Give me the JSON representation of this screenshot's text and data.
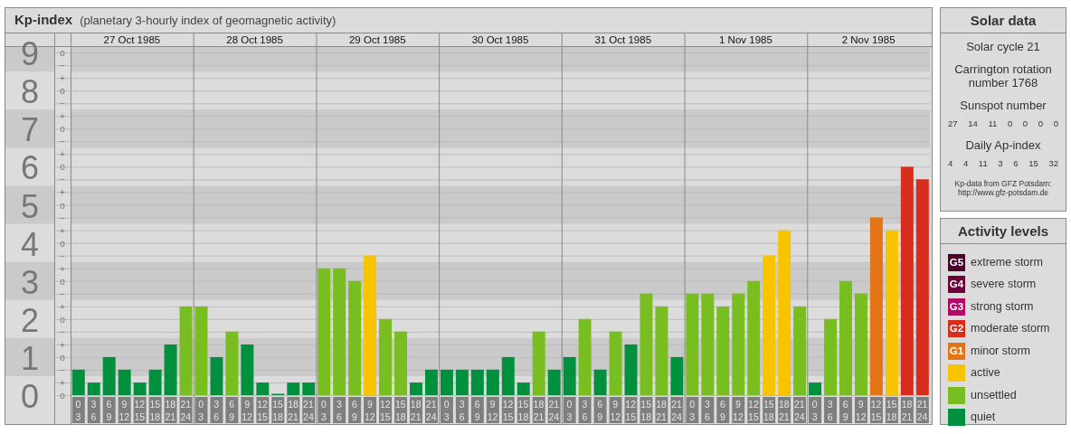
{
  "header": {
    "title": "Kp-index",
    "subtitle": "(planetary 3-hourly index of geomagnetic activity)"
  },
  "days": [
    "27 Oct 1985",
    "28 Oct 1985",
    "29 Oct 1985",
    "30 Oct 1985",
    "31 Oct 1985",
    "1 Nov 1985",
    "2 Nov 1985"
  ],
  "minor_tick_labels": [
    "o",
    "−",
    "+",
    "o",
    "−",
    "+",
    "o",
    "−",
    "+",
    "o",
    "−",
    "+",
    "o",
    "−",
    "+",
    "o",
    "−",
    "+",
    "o",
    "−",
    "+",
    "o",
    "−",
    "+",
    "o",
    "−",
    "+",
    "o"
  ],
  "chart": {
    "chart_data": {
      "type": "bar",
      "grid": true,
      "ylim": [
        0,
        9.17
      ],
      "bands": [
        {
          "axis": "y",
          "from": 0.5,
          "to": 1.5
        },
        {
          "axis": "y",
          "from": 2.5,
          "to": 3.5
        },
        {
          "axis": "y",
          "from": 4.5,
          "to": 5.5
        },
        {
          "axis": "y",
          "from": 6.5,
          "to": 7.5
        },
        {
          "axis": "y",
          "from": 8.5,
          "to": 9.17
        }
      ],
      "yticks": [
        0,
        1,
        2,
        3,
        4,
        5,
        6,
        7,
        8,
        9
      ],
      "categories": [
        "0 3",
        "3 6",
        "6 9",
        "9 12",
        "12 15",
        "15 18",
        "18 21",
        "21 24",
        "0 3",
        "3 6",
        "6 9",
        "9 12",
        "12 15",
        "15 18",
        "18 21",
        "21 24",
        "0 3",
        "3 6",
        "6 9",
        "9 12",
        "12 15",
        "15 18",
        "18 21",
        "21 24",
        "0 3",
        "3 6",
        "6 9",
        "9 12",
        "12 15",
        "15 18",
        "18 21",
        "21 24",
        "0 3",
        "3 6",
        "6 9",
        "9 12",
        "12 15",
        "15 18",
        "18 21",
        "21 24",
        "0 3",
        "3 6",
        "6 9",
        "9 12",
        "12 15",
        "15 18",
        "18 21",
        "21 24",
        "0 3",
        "3 6",
        "6 9",
        "9 12",
        "12 15",
        "15 18",
        "18 21",
        "21 24"
      ],
      "series": [
        {
          "color": "#00903e",
          "values": [
            0.67,
            0.33,
            1,
            0.67,
            0.33,
            0.67,
            1.33,
            null,
            null,
            1,
            null,
            1.33,
            0.33,
            0,
            0.33,
            0.33,
            null,
            null,
            null,
            null,
            null,
            null,
            0.33,
            0.67,
            0.67,
            0.67,
            0.67,
            0.67,
            1,
            0.33,
            null,
            0.67,
            1,
            null,
            0.67,
            null,
            1.33,
            null,
            null,
            1,
            null,
            null,
            null,
            null,
            null,
            null,
            null,
            null,
            0.33,
            null,
            null,
            null,
            null,
            null,
            null,
            null
          ]
        },
        {
          "color": "#78be20",
          "values": [
            null,
            null,
            null,
            null,
            null,
            null,
            null,
            2.33,
            2.33,
            null,
            1.67,
            null,
            null,
            null,
            null,
            null,
            3.33,
            3.33,
            3,
            null,
            2,
            1.67,
            null,
            null,
            null,
            null,
            null,
            null,
            null,
            null,
            1.67,
            null,
            null,
            2,
            null,
            1.67,
            null,
            2.67,
            2.33,
            null,
            2.67,
            2.67,
            2.33,
            2.67,
            3,
            null,
            null,
            2.33,
            null,
            2,
            3,
            2.67,
            null,
            null,
            null,
            null
          ]
        },
        {
          "color": "#f8c400",
          "values": [
            null,
            null,
            null,
            null,
            null,
            null,
            null,
            null,
            null,
            null,
            null,
            null,
            null,
            null,
            null,
            null,
            null,
            null,
            null,
            3.67,
            null,
            null,
            null,
            null,
            null,
            null,
            null,
            null,
            null,
            null,
            null,
            null,
            null,
            null,
            null,
            null,
            null,
            null,
            null,
            null,
            null,
            null,
            null,
            null,
            null,
            3.67,
            4.33,
            null,
            null,
            null,
            null,
            null,
            null,
            4.33,
            null,
            null
          ]
        },
        {
          "color": "#e47516",
          "values": [
            null,
            null,
            null,
            null,
            null,
            null,
            null,
            null,
            null,
            null,
            null,
            null,
            null,
            null,
            null,
            null,
            null,
            null,
            null,
            null,
            null,
            null,
            null,
            null,
            null,
            null,
            null,
            null,
            null,
            null,
            null,
            null,
            null,
            null,
            null,
            null,
            null,
            null,
            null,
            null,
            null,
            null,
            null,
            null,
            null,
            null,
            null,
            null,
            null,
            null,
            null,
            null,
            4.67,
            null,
            null,
            null
          ]
        },
        {
          "color": "#d62d1d",
          "values": [
            null,
            null,
            null,
            null,
            null,
            null,
            null,
            null,
            null,
            null,
            null,
            null,
            null,
            null,
            null,
            null,
            null,
            null,
            null,
            null,
            null,
            null,
            null,
            null,
            null,
            null,
            null,
            null,
            null,
            null,
            null,
            null,
            null,
            null,
            null,
            null,
            null,
            null,
            null,
            null,
            null,
            null,
            null,
            null,
            null,
            null,
            null,
            null,
            null,
            null,
            null,
            null,
            null,
            null,
            6,
            5.67
          ]
        }
      ]
    }
  },
  "solar_data": {
    "title": "Solar data",
    "cycle": "Solar cycle 21",
    "carrington": "Carrington rotation number 1768",
    "sunspot_label": "Sunspot number",
    "sunspot_values": [
      "27",
      "14",
      "11",
      "0",
      "0",
      "0",
      "0"
    ],
    "ap_label": "Daily Ap-index",
    "ap_values": [
      "4",
      "4",
      "11",
      "3",
      "6",
      "15",
      "32"
    ],
    "source": "Kp-data from GFZ Potsdam:",
    "source_url": "http://www.gfz-potsdam.de"
  },
  "activity_levels": {
    "title": "Activity levels",
    "items": [
      {
        "badge": "G5",
        "label": "extreme storm",
        "color": "#4a0028"
      },
      {
        "badge": "G4",
        "label": "severe storm",
        "color": "#6e0038"
      },
      {
        "badge": "G3",
        "label": "strong storm",
        "color": "#b00a62"
      },
      {
        "badge": "G2",
        "label": "moderate storm",
        "color": "#d62d1d"
      },
      {
        "badge": "G1",
        "label": "minor storm",
        "color": "#e47516"
      },
      {
        "label": "active",
        "color": "#f8c400"
      },
      {
        "label": "unsettled",
        "color": "#78be20"
      },
      {
        "label": "quiet",
        "color": "#00903e"
      }
    ]
  }
}
